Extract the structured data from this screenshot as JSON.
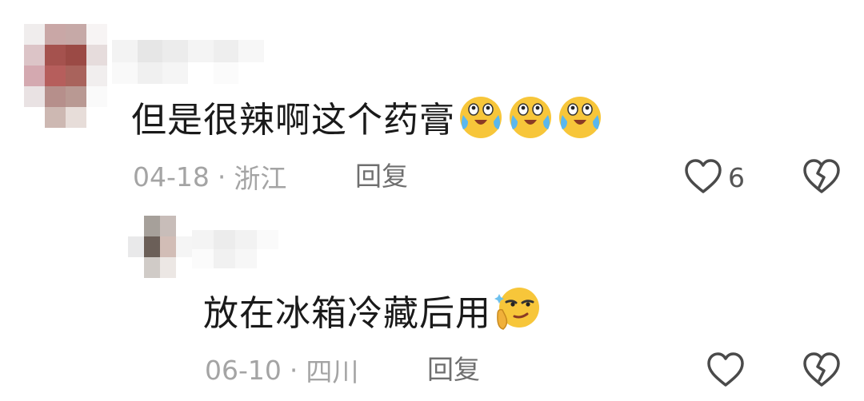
{
  "comments": [
    {
      "text": "但是很辣啊这个药膏",
      "emojis": [
        "crying-laugh-emoji",
        "crying-laugh-emoji",
        "crying-laugh-emoji"
      ],
      "date": "04-18",
      "location": "浙江",
      "reply_label": "回复",
      "like_count": "6"
    },
    {
      "text": "放在冰箱冷藏后用",
      "emojis": [
        "thinking-smirk-emoji"
      ],
      "date": "06-10",
      "location": "四川",
      "reply_label": "回复",
      "like_count": ""
    }
  ],
  "separator": "·",
  "icons": {
    "like": "heart-outline-icon",
    "dislike": "broken-heart-icon"
  },
  "colors": {
    "text": "#1a1a1a",
    "meta": "#a4a4a4",
    "reply": "#6f6f6f",
    "icon": "#4a4a4a"
  }
}
